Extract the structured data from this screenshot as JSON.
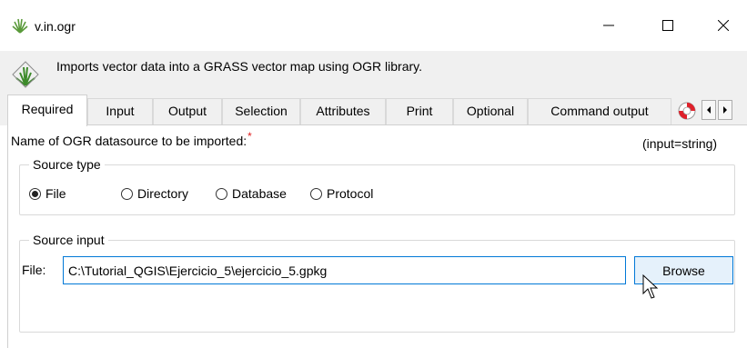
{
  "window": {
    "title": "v.in.ogr",
    "icon": "grass-logo-icon",
    "controls": [
      "minimize-icon",
      "maximize-icon",
      "close-icon"
    ]
  },
  "header": {
    "description": "Imports vector data into a GRASS vector map using OGR library."
  },
  "tabs": [
    {
      "label": "Required",
      "active": true
    },
    {
      "label": "Input",
      "active": false
    },
    {
      "label": "Output",
      "active": false
    },
    {
      "label": "Selection",
      "active": false
    },
    {
      "label": "Attributes",
      "active": false
    },
    {
      "label": "Print",
      "active": false
    },
    {
      "label": "Optional",
      "active": false
    },
    {
      "label": "Command output",
      "active": false
    }
  ],
  "required": {
    "datasource_label": "Name of OGR datasource to be imported:",
    "required_marker": "*",
    "param_hint": "(input=string)",
    "source_type": {
      "title": "Source type",
      "options": [
        {
          "label": "File",
          "selected": true
        },
        {
          "label": "Directory",
          "selected": false
        },
        {
          "label": "Database",
          "selected": false
        },
        {
          "label": "Protocol",
          "selected": false
        }
      ]
    },
    "source_input": {
      "title": "Source input",
      "file_label": "File:",
      "file_value": "C:\\Tutorial_QGIS\\Ejercicio_5\\ejercicio_5.gpkg",
      "browse_label": "Browse"
    }
  },
  "colors": {
    "accent": "#0078d7",
    "header_bg": "#f0f0f0",
    "required_star": "#e02020"
  }
}
